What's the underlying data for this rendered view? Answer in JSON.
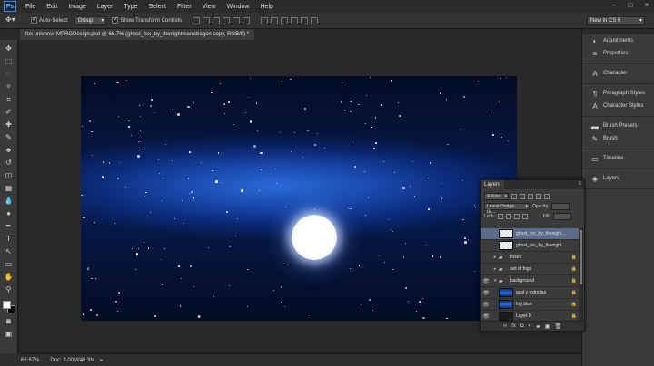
{
  "app": {
    "logo": "Ps"
  },
  "menu": [
    "File",
    "Edit",
    "Image",
    "Layer",
    "Type",
    "Select",
    "Filter",
    "View",
    "Window",
    "Help"
  ],
  "window_controls": [
    "–",
    "□",
    "×"
  ],
  "options_bar": {
    "auto_select_label": "Auto-Select:",
    "auto_select_checked": true,
    "auto_select_target": "Group",
    "show_transform_label": "Show Transform Controls",
    "show_transform_checked": true,
    "workspace": "New in CS 6"
  },
  "document_tab": "fox universe MPRGDesign.psd @ 66.7% (ghost_fox_by_thenightmaredragon copy, RGB/8) *",
  "status_bar": {
    "zoom": "66.67%",
    "doc_info": "Doc: 3.00M/46.3M"
  },
  "dock": {
    "groups": [
      [
        {
          "icon": "adjustments-icon",
          "glyph": "◐",
          "label": "Adjustments"
        },
        {
          "icon": "properties-icon",
          "glyph": "≡",
          "label": "Properties"
        }
      ],
      [
        {
          "icon": "character-icon",
          "glyph": "A",
          "label": "Character"
        }
      ],
      [
        {
          "icon": "paragraph-styles-icon",
          "glyph": "¶",
          "label": "Paragraph Styles"
        },
        {
          "icon": "character-styles-icon",
          "glyph": "A",
          "label": "Character Styles"
        }
      ],
      [
        {
          "icon": "brush-presets-icon",
          "glyph": "▬",
          "label": "Brush Presets"
        },
        {
          "icon": "brush-icon",
          "glyph": "✎",
          "label": "Brush"
        }
      ],
      [
        {
          "icon": "timeline-icon",
          "glyph": "▭",
          "label": "Timeline"
        }
      ],
      [
        {
          "icon": "layers-icon",
          "glyph": "◈",
          "label": "Layers"
        }
      ]
    ]
  },
  "layers_panel": {
    "title": "Layers",
    "filter_kind": "Kind",
    "blend_mode": "Linear Dodge (A...",
    "opacity_label": "Opacity:",
    "lock_label": "Lock:",
    "fill_label": "Fill:",
    "layers": [
      {
        "name": "ghost_fox_by_thenight...",
        "visible": false,
        "type": "layer",
        "thumb": "checker",
        "selected": true,
        "locked": false
      },
      {
        "name": "ghost_fox_by_thenight...",
        "visible": false,
        "type": "layer",
        "thumb": "checker",
        "selected": false,
        "locked": false
      },
      {
        "name": "foxes",
        "visible": false,
        "type": "group",
        "thumb": "folder",
        "selected": false,
        "locked": true
      },
      {
        "name": "set of fogs",
        "visible": false,
        "type": "group",
        "thumb": "folder",
        "selected": false,
        "locked": true
      },
      {
        "name": "background",
        "visible": true,
        "type": "group-open",
        "thumb": "folder",
        "selected": false,
        "locked": true
      },
      {
        "name": "azul y estrellas",
        "visible": true,
        "type": "layer",
        "thumb": "blue",
        "selected": false,
        "locked": true
      },
      {
        "name": "fog blue",
        "visible": true,
        "type": "layer",
        "thumb": "blue",
        "selected": false,
        "locked": true
      },
      {
        "name": "Layer 0",
        "visible": true,
        "type": "layer",
        "thumb": "fog",
        "selected": false,
        "locked": true
      }
    ],
    "footer_icons": [
      "link-icon",
      "fx-icon",
      "mask-icon",
      "adjustment-layer-icon",
      "group-folder-icon",
      "new-layer-icon",
      "trash-icon"
    ]
  },
  "tools": [
    "move-tool-icon",
    "marquee-tool-icon",
    "lasso-tool-icon",
    "quick-select-tool-icon",
    "crop-tool-icon",
    "eyedropper-tool-icon",
    "healing-brush-tool-icon",
    "brush-tool-icon",
    "clone-stamp-tool-icon",
    "history-brush-tool-icon",
    "eraser-tool-icon",
    "gradient-tool-icon",
    "blur-tool-icon",
    "dodge-tool-icon",
    "pen-tool-icon",
    "type-tool-icon",
    "path-select-tool-icon",
    "shape-tool-icon",
    "hand-tool-icon",
    "zoom-tool-icon"
  ],
  "tool_glyphs": [
    "✥",
    "⬚",
    "◌",
    "✧",
    "⌗",
    "✐",
    "✚",
    "✎",
    "♣",
    "↺",
    "◫",
    "▦",
    "💧",
    "●",
    "✒",
    "T",
    "↖",
    "▭",
    "✋",
    "⚲"
  ]
}
